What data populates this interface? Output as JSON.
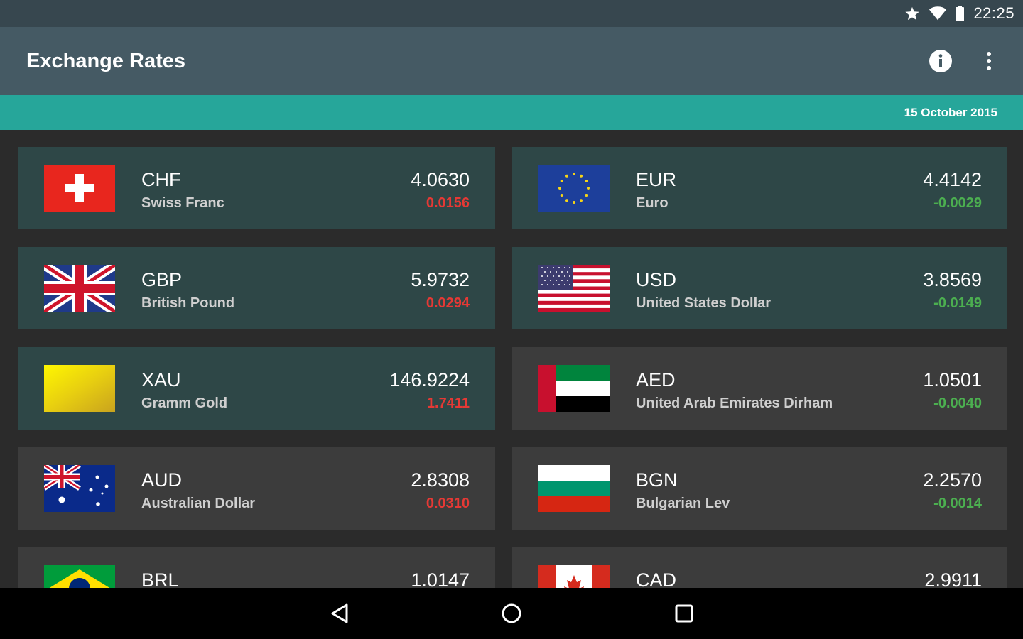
{
  "status_bar": {
    "time": "22:25",
    "icons": [
      "star-icon",
      "wifi-icon",
      "battery-icon"
    ]
  },
  "app_bar": {
    "title": "Exchange Rates",
    "actions": [
      "info-icon",
      "more-vert-icon"
    ]
  },
  "date_strip": {
    "date": "15 October 2015"
  },
  "colors": {
    "accent": "#26a69a",
    "appbar": "#455a64",
    "up": "#e53935",
    "down": "#4caf50"
  },
  "rates": [
    {
      "code": "CHF",
      "name": "Swiss Franc",
      "rate": "4.0630",
      "change": "0.0156",
      "direction": "up",
      "flag": "switzerland-flag-icon"
    },
    {
      "code": "EUR",
      "name": "Euro",
      "rate": "4.4142",
      "change": "-0.0029",
      "direction": "down",
      "flag": "eu-flag-icon"
    },
    {
      "code": "GBP",
      "name": "British Pound",
      "rate": "5.9732",
      "change": "0.0294",
      "direction": "up",
      "flag": "uk-flag-icon"
    },
    {
      "code": "USD",
      "name": "United States Dollar",
      "rate": "3.8569",
      "change": "-0.0149",
      "direction": "down",
      "flag": "us-flag-icon"
    },
    {
      "code": "XAU",
      "name": "Gramm Gold",
      "rate": "146.9224",
      "change": "1.7411",
      "direction": "up",
      "flag": "gold-icon"
    },
    {
      "code": "AED",
      "name": "United Arab Emirates Dirham",
      "rate": "1.0501",
      "change": "-0.0040",
      "direction": "down",
      "flag": "uae-flag-icon"
    },
    {
      "code": "AUD",
      "name": "Australian Dollar",
      "rate": "2.8308",
      "change": "0.0310",
      "direction": "up",
      "flag": "australia-flag-icon"
    },
    {
      "code": "BGN",
      "name": "Bulgarian Lev",
      "rate": "2.2570",
      "change": "-0.0014",
      "direction": "down",
      "flag": "bulgaria-flag-icon"
    },
    {
      "code": "BRL",
      "name": "",
      "rate": "1.0147",
      "change": "",
      "direction": "",
      "flag": "brazil-flag-icon"
    },
    {
      "code": "CAD",
      "name": "",
      "rate": "2.9911",
      "change": "",
      "direction": "",
      "flag": "canada-flag-icon"
    }
  ],
  "nav_bar": {
    "buttons": [
      "back-icon",
      "home-icon",
      "recents-icon"
    ]
  }
}
